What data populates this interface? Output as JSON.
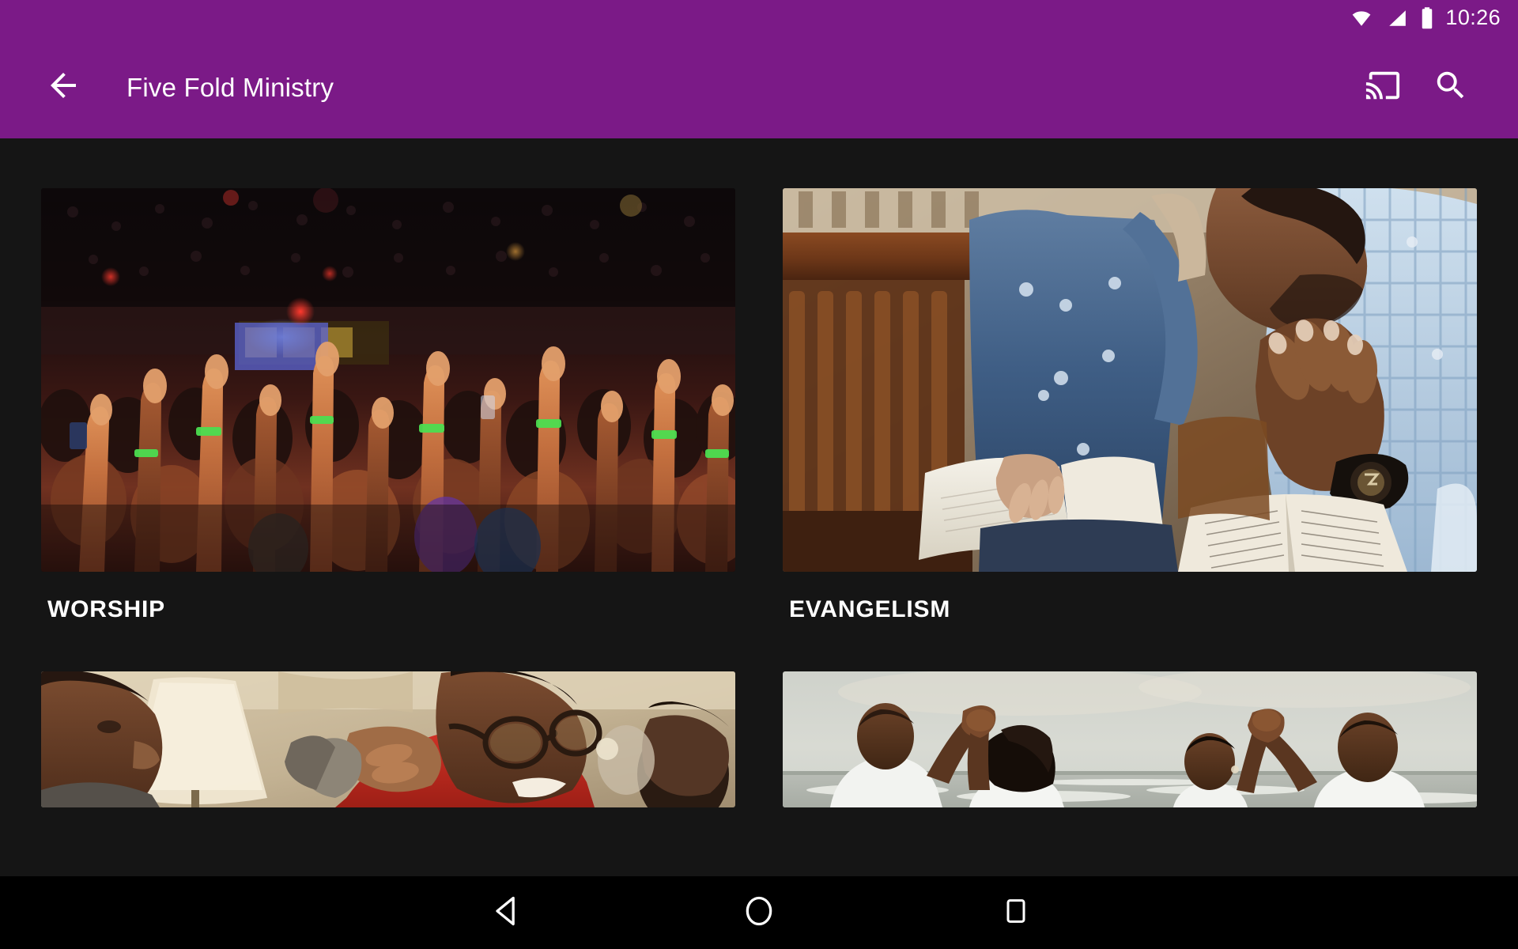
{
  "status_bar": {
    "time": "10:26",
    "icons": [
      "wifi-icon",
      "cell-signal-icon",
      "battery-icon"
    ]
  },
  "app_bar": {
    "title": "Five Fold Ministry",
    "back_icon": "back-arrow-icon",
    "cast_icon": "cast-icon",
    "search_icon": "search-icon",
    "background_color": "#7B1A87"
  },
  "theme": {
    "background_color": "#151515",
    "accent_color": "#7B1A87",
    "text_color": "#FFFFFF"
  },
  "main": {
    "cards": [
      {
        "label": "WORSHIP",
        "image_name": "worship-crowd-hands-raised-image",
        "alt": "Dark concert hall crowd with many hands raised toward stage lights"
      },
      {
        "label": "EVANGELISM",
        "image_name": "evangelism-men-praying-bible-image",
        "alt": "Two men in denim shirts praying with open Bibles on a wooden bench"
      },
      {
        "label": "",
        "image_name": "teaching-men-talking-lamp-image",
        "alt": "Smiling man in red shirt with glasses being encouraged indoors near a lamp"
      },
      {
        "label": "",
        "image_name": "beach-hands-raised-worship-image",
        "alt": "Four people in white clothing on a beach with hands joined and raised"
      }
    ]
  },
  "nav_bar": {
    "back_label": "Back",
    "home_label": "Home",
    "recents_label": "Recents",
    "back_icon": "nav-back-triangle-icon",
    "home_icon": "nav-home-circle-icon",
    "recents_icon": "nav-recents-square-icon"
  }
}
